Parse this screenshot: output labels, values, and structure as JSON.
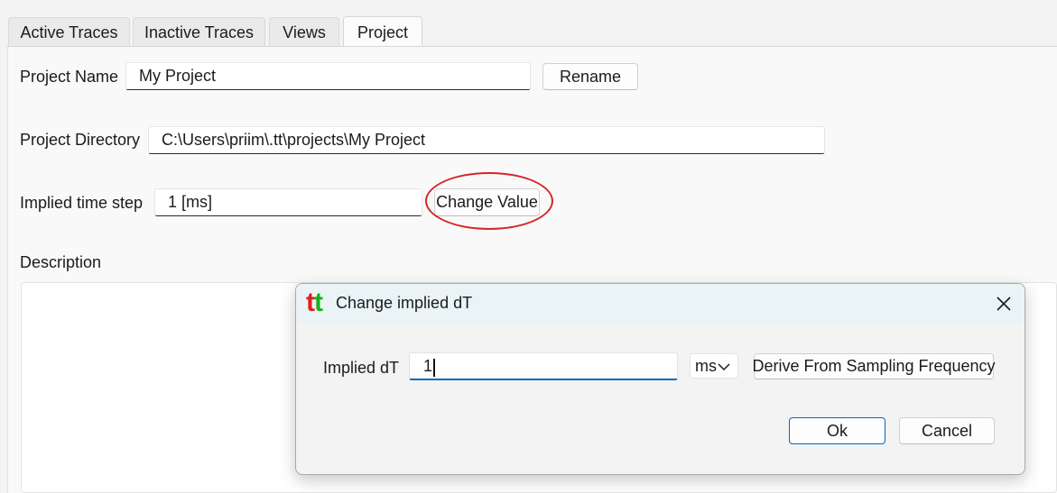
{
  "tabs": [
    {
      "label": "Active Traces",
      "active": false
    },
    {
      "label": "Inactive Traces",
      "active": false
    },
    {
      "label": "Views",
      "active": false
    },
    {
      "label": "Project",
      "active": true
    }
  ],
  "project": {
    "name_label": "Project Name",
    "name_value": "My Project",
    "rename_button": "Rename",
    "directory_label": "Project Directory",
    "directory_value": "C:\\Users\\priim\\.tt\\projects\\My Project",
    "time_step_label": "Implied time step",
    "time_step_value": "1 [ms]",
    "change_value_button": "Change Value",
    "description_label": "Description",
    "description_value": ""
  },
  "dialog": {
    "logo_text": "tt",
    "title": "Change implied dT",
    "close_icon": "close-icon",
    "dt_label": "Implied dT",
    "dt_value": "1",
    "unit_selected": "ms",
    "derive_button": "Derive From Sampling Frequency",
    "ok_button": "Ok",
    "cancel_button": "Cancel"
  },
  "colors": {
    "highlight": "#d6262b",
    "logo_t1": "#e02020",
    "logo_t2": "#18b018",
    "focus_accent": "#0067c0"
  }
}
